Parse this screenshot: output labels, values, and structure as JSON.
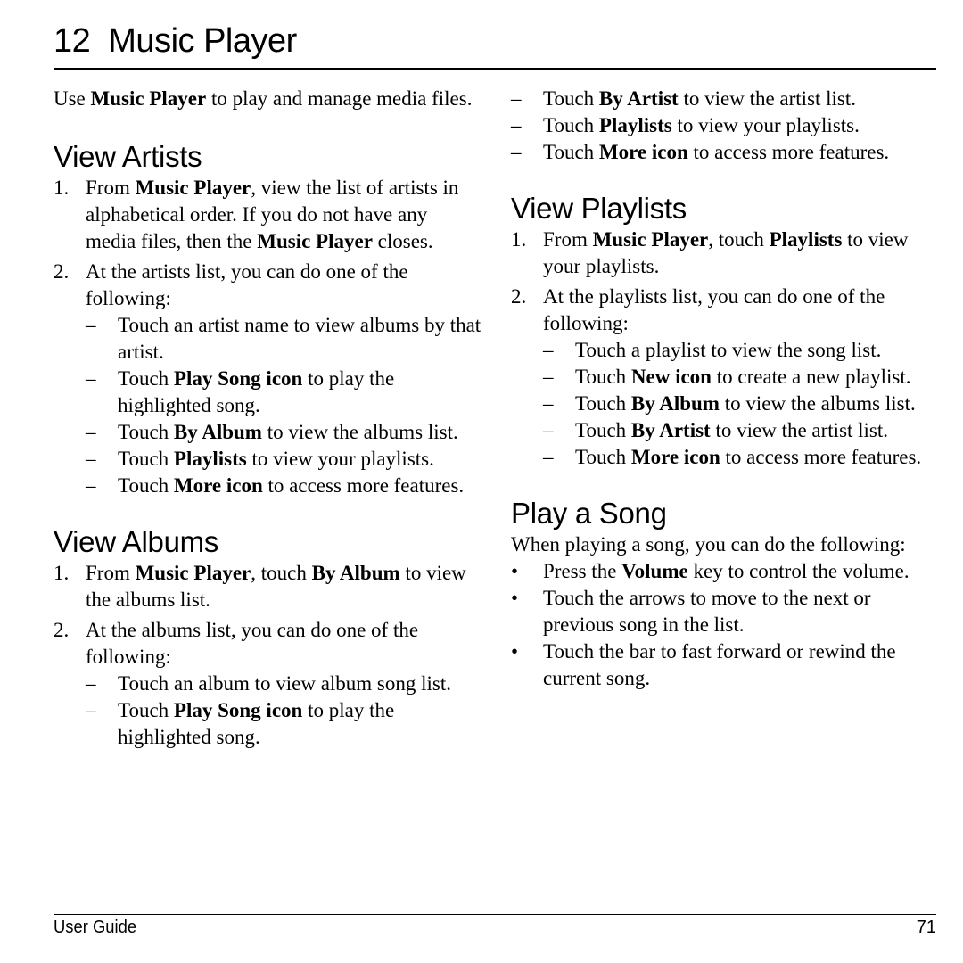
{
  "header": {
    "chapter_number": "12",
    "chapter_title": "Music Player"
  },
  "intro": {
    "pre": "Use ",
    "bold": "Music Player",
    "post": " to play and manage media files."
  },
  "view_artists": {
    "heading": "View Artists",
    "steps": [
      {
        "marker": "1.",
        "parts": [
          {
            "t": "From "
          },
          {
            "b": "Music Player"
          },
          {
            "t": ", view the list of artists in alphabetical order. If you do not have any media files, then the "
          },
          {
            "b": "Music Player"
          },
          {
            "t": " closes."
          }
        ]
      },
      {
        "marker": "2.",
        "parts": [
          {
            "t": "At the artists list, you can do one of the following:"
          }
        ],
        "sub": [
          {
            "parts": [
              {
                "t": "Touch an artist name to view albums by that artist."
              }
            ]
          },
          {
            "parts": [
              {
                "t": "Touch "
              },
              {
                "b": "Play Song icon"
              },
              {
                "t": " to play the highlighted song."
              }
            ]
          },
          {
            "parts": [
              {
                "t": "Touch "
              },
              {
                "b": "By Album"
              },
              {
                "t": " to view the albums list."
              }
            ]
          },
          {
            "parts": [
              {
                "t": "Touch "
              },
              {
                "b": "Playlists"
              },
              {
                "t": " to view your playlists."
              }
            ]
          },
          {
            "parts": [
              {
                "t": "Touch "
              },
              {
                "b": "More icon"
              },
              {
                "t": " to access more features."
              }
            ]
          }
        ]
      }
    ]
  },
  "view_albums": {
    "heading": "View Albums",
    "steps": [
      {
        "marker": "1.",
        "parts": [
          {
            "t": "From "
          },
          {
            "b": "Music Player"
          },
          {
            "t": ", touch "
          },
          {
            "b": "By Album"
          },
          {
            "t": " to view the albums list."
          }
        ]
      },
      {
        "marker": "2.",
        "parts": [
          {
            "t": "At the albums list, you can do one of the following:"
          }
        ],
        "sub": [
          {
            "parts": [
              {
                "t": "Touch an album to view album song list."
              }
            ]
          },
          {
            "parts": [
              {
                "t": "Touch "
              },
              {
                "b": "Play Song icon"
              },
              {
                "t": " to play the highlighted song."
              }
            ]
          }
        ]
      }
    ]
  },
  "albums_continued": [
    {
      "parts": [
        {
          "t": "Touch "
        },
        {
          "b": "By Artist"
        },
        {
          "t": " to view the artist list."
        }
      ]
    },
    {
      "parts": [
        {
          "t": "Touch "
        },
        {
          "b": "Playlists"
        },
        {
          "t": " to view your playlists."
        }
      ]
    },
    {
      "parts": [
        {
          "t": "Touch "
        },
        {
          "b": "More icon"
        },
        {
          "t": " to access more features."
        }
      ]
    }
  ],
  "view_playlists": {
    "heading": "View Playlists",
    "steps": [
      {
        "marker": "1.",
        "parts": [
          {
            "t": "From "
          },
          {
            "b": "Music Player"
          },
          {
            "t": ", touch "
          },
          {
            "b": "Playlists"
          },
          {
            "t": " to view your playlists."
          }
        ]
      },
      {
        "marker": "2.",
        "parts": [
          {
            "t": "At the playlists list, you can do one of the following:"
          }
        ],
        "sub": [
          {
            "parts": [
              {
                "t": "Touch a playlist to view the song list."
              }
            ]
          },
          {
            "parts": [
              {
                "t": "Touch "
              },
              {
                "b": "New icon"
              },
              {
                "t": " to create a new playlist."
              }
            ]
          },
          {
            "parts": [
              {
                "t": "Touch "
              },
              {
                "b": "By Album"
              },
              {
                "t": " to view the albums list."
              }
            ]
          },
          {
            "parts": [
              {
                "t": "Touch "
              },
              {
                "b": "By Artist"
              },
              {
                "t": " to view the artist list."
              }
            ]
          },
          {
            "parts": [
              {
                "t": "Touch "
              },
              {
                "b": "More icon"
              },
              {
                "t": " to access more features."
              }
            ]
          }
        ]
      }
    ]
  },
  "play_song": {
    "heading": "Play a Song",
    "intro": "When playing a song, you can do the following:",
    "bullets": [
      {
        "parts": [
          {
            "t": "Press the "
          },
          {
            "b": "Volume"
          },
          {
            "t": " key to control the volume."
          }
        ]
      },
      {
        "parts": [
          {
            "t": "Touch the arrows to move to the next or previous song in the list."
          }
        ]
      },
      {
        "parts": [
          {
            "t": "Touch the bar to fast forward or rewind the current song."
          }
        ]
      }
    ]
  },
  "markers": {
    "dash": "–",
    "bullet": "•"
  },
  "footer": {
    "label": "User Guide",
    "page_number": "71"
  }
}
